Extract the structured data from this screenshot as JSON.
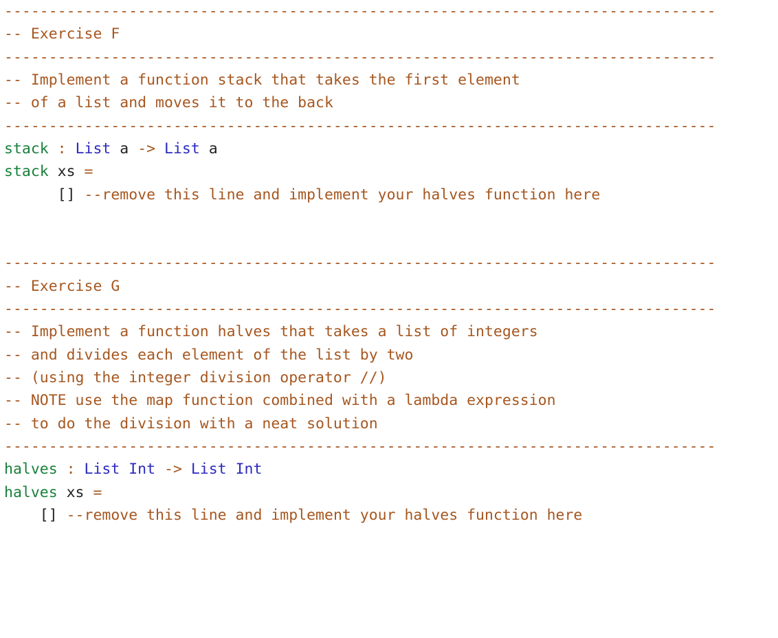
{
  "code": {
    "hr": "--------------------------------------------------------------------------------",
    "exF": {
      "title": "-- Exercise F",
      "desc1": "-- Implement a function stack that takes the first element",
      "desc2": "-- of a list and moves it to the back",
      "sig": {
        "name": "stack",
        "sep": " : ",
        "t1": "List",
        "a1": " a ",
        "arrow": "->",
        "t2": " List",
        "a2": " a"
      },
      "def": {
        "name": "stack",
        "args": " xs ",
        "eq": "="
      },
      "body": {
        "indent": "      ",
        "expr": "[]",
        "comment": " --remove this line and implement your halves function here"
      }
    },
    "exG": {
      "title": "-- Exercise G",
      "desc1": "-- Implement a function halves that takes a list of integers",
      "desc2": "-- and divides each element of the list by two",
      "desc3": "-- (using the integer division operator //)",
      "desc4": "-- NOTE use the map function combined with a lambda expression",
      "desc5": "-- to do the division with a neat solution",
      "sig": {
        "name": "halves",
        "sep": " : ",
        "t1": "List",
        "i1": " Int",
        "arrow": " -> ",
        "t2": "List",
        "i2": " Int"
      },
      "def": {
        "name": "halves",
        "args": " xs ",
        "eq": "="
      },
      "body": {
        "indent": "    ",
        "expr": "[]",
        "comment": " --remove this line and implement your halves function here"
      }
    }
  }
}
